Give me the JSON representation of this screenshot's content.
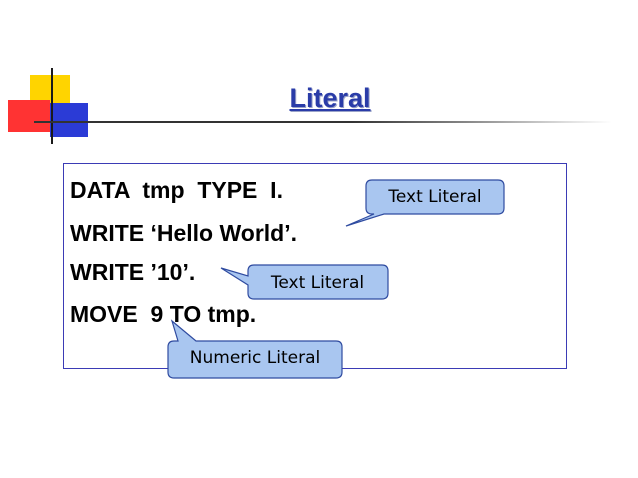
{
  "slide": {
    "title": "Literal",
    "code_lines": [
      "DATA  tmp  TYPE  I.",
      "WRITE ‘Hello World’.",
      "WRITE ’10’.",
      "MOVE  9 TO tmp."
    ],
    "callouts": [
      {
        "label": "Text Literal"
      },
      {
        "label": "Text Literal"
      },
      {
        "label": "Numeric Literal"
      }
    ]
  },
  "colors": {
    "title": "#2a3ca8",
    "callout_fill": "#a9c6f0",
    "callout_border": "#2f4ba0",
    "box_border": "#3b3bb5",
    "logo_yellow": "#ffd400",
    "logo_red": "#ff3333",
    "logo_blue": "#2b3bd6"
  }
}
